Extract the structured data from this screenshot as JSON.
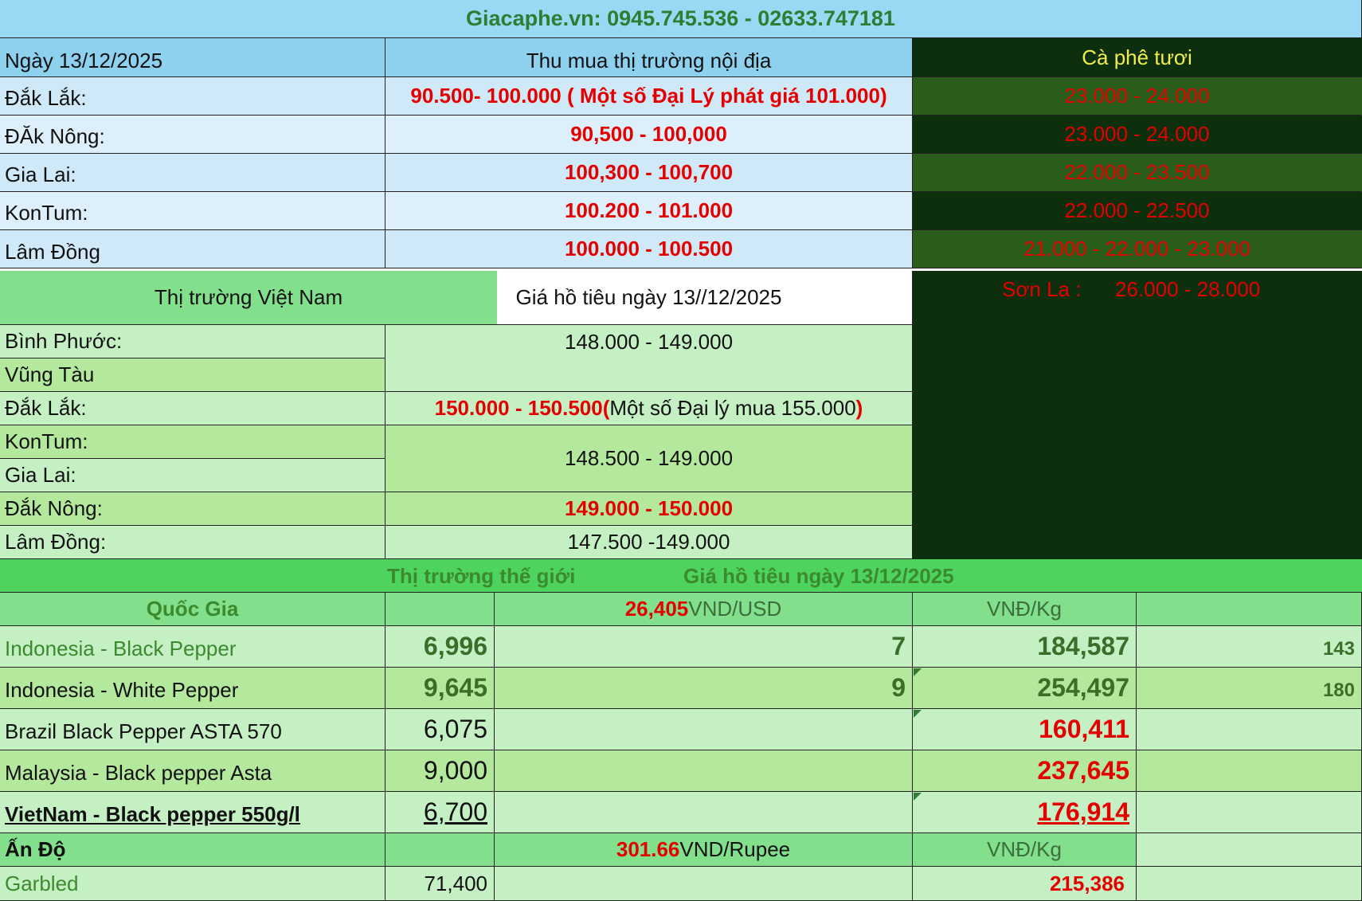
{
  "header": {
    "brand": "Giacaphe.vn",
    "phones": " : 0945.745.536 - 02633.747181"
  },
  "coffee": {
    "date_label": "Ngày 13/12/2025",
    "col_domestic": "Thu mua thị trường nội địa",
    "col_fresh": "Cà phê tươi",
    "rows": [
      {
        "region": "Đắk Lắk:",
        "price": "90.500- 100.000 ( Một số Đại Lý phát giá 101.000)",
        "fresh": "23.000 - 24.000"
      },
      {
        "region": "ĐĂk Nông:",
        "price": "90,500 - 100,000",
        "fresh": "23.000 - 24.000"
      },
      {
        "region": "Gia Lai:",
        "price": "100,300 - 100,700",
        "fresh": "22.000 - 23.500"
      },
      {
        "region": "KonTum:",
        "price": "100.200 - 101.000",
        "fresh": "22.000 - 22.500"
      },
      {
        "region": "Lâm Đồng",
        "price": "100.000 - 100.500",
        "fresh": "21.000 - 22.000 - 23.000"
      }
    ],
    "sonla_label": "Sơn La :",
    "sonla_price": "26.000 - 28.000"
  },
  "pepper_vn": {
    "col_market": "Thị trường Việt Nam",
    "col_price": "Giá hồ tiêu ngày 13//12/2025",
    "rows": [
      {
        "region": "Bình Phước:"
      },
      {
        "region": "Vũng Tàu"
      },
      {
        "region": "Đắk Lắk:"
      },
      {
        "region": "KonTum:"
      },
      {
        "region": "Gia Lai:"
      },
      {
        "region": "Đắk Nông:"
      },
      {
        "region": "Lâm Đồng:"
      }
    ],
    "price_binhphuoc": "148.000 - 149.000",
    "price_daklak": "150.000 - 150.500",
    "note_daklak_open": "(",
    "note_daklak_text": " Một số Đại lý mua 155.000",
    "note_daklak_close": ")",
    "price_kontum_gialai": "148.500 - 149.000",
    "price_daknong": "149.000 - 150.000",
    "price_lamdong": "147.500 -149.000"
  },
  "pepper_world": {
    "title_left": "Thị trường thế giới",
    "title_right": "Giá hồ tiêu ngày 13/12/2025",
    "col_country": "Quốc Gia",
    "fx_rate": "26,405",
    "fx_unit": "VND/USD",
    "col_vndkg": "VNĐ/Kg",
    "rows": [
      {
        "name": "Indonesia - Black Pepper",
        "usd": "6,996",
        "change": "7",
        "vnd": "184,587",
        "extra": "143"
      },
      {
        "name": "Indonesia - White Pepper",
        "usd": "9,645",
        "change": "9",
        "vnd": "254,497",
        "extra": "180"
      },
      {
        "name": "Brazil Black Pepper  ASTA 570",
        "usd": "6,075",
        "change": "",
        "vnd": "160,411",
        "extra": ""
      },
      {
        "name": "Malaysia - Black pepper Asta",
        "usd": "9,000",
        "change": "",
        "vnd": "237,645",
        "extra": ""
      },
      {
        "name": "VietNam - Black pepper 550g/l",
        "usd": "6,700",
        "change": "",
        "vnd": "176,914",
        "extra": ""
      }
    ],
    "india_label": "Ấn Độ",
    "inr_rate": "301.66",
    "inr_unit": "VND/Rupee",
    "india_vndkg": "VNĐ/Kg",
    "garbled_name": "Garbled",
    "garbled_inr": "71,400",
    "garbled_vnd": "215,386"
  },
  "colors": {
    "header_bg": "#99d9f3",
    "coffee_head_bg": "#8ed1ef",
    "coffee_row_bg": "#cfe9f8",
    "dark_green": "#0d2f0d",
    "mid_green": "#2a5c1a",
    "pepper_head_bg": "#82e08c",
    "light_green": "#c4f0c4",
    "mid_light_green": "#b4e89c",
    "world_title_bg": "#4fd35f",
    "price_red": "#e50000"
  }
}
